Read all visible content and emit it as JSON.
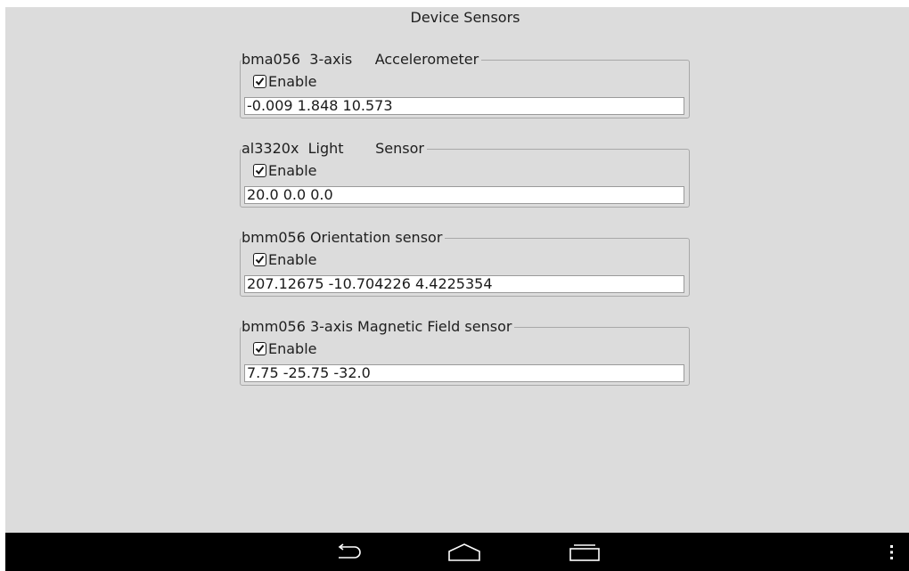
{
  "title": "Device Sensors",
  "sensors": [
    {
      "name": "bma056  3-axis     Accelerometer",
      "enable_label": "Enable",
      "enabled": true,
      "value": "-0.009 1.848 10.573"
    },
    {
      "name": "al3320x  Light       Sensor",
      "enable_label": "Enable",
      "enabled": true,
      "value": "20.0 0.0 0.0"
    },
    {
      "name": "bmm056 Orientation sensor",
      "enable_label": "Enable",
      "enabled": true,
      "value": "207.12675 -10.704226 4.4225354"
    },
    {
      "name": "bmm056 3-axis Magnetic Field sensor",
      "enable_label": "Enable",
      "enabled": true,
      "value": "7.75 -25.75 -32.0"
    }
  ],
  "navbar": {
    "icons": [
      "back-icon",
      "home-icon",
      "recent-apps-icon",
      "overflow-menu-icon"
    ],
    "background": "#000000",
    "icon_color": "#ffffff"
  }
}
